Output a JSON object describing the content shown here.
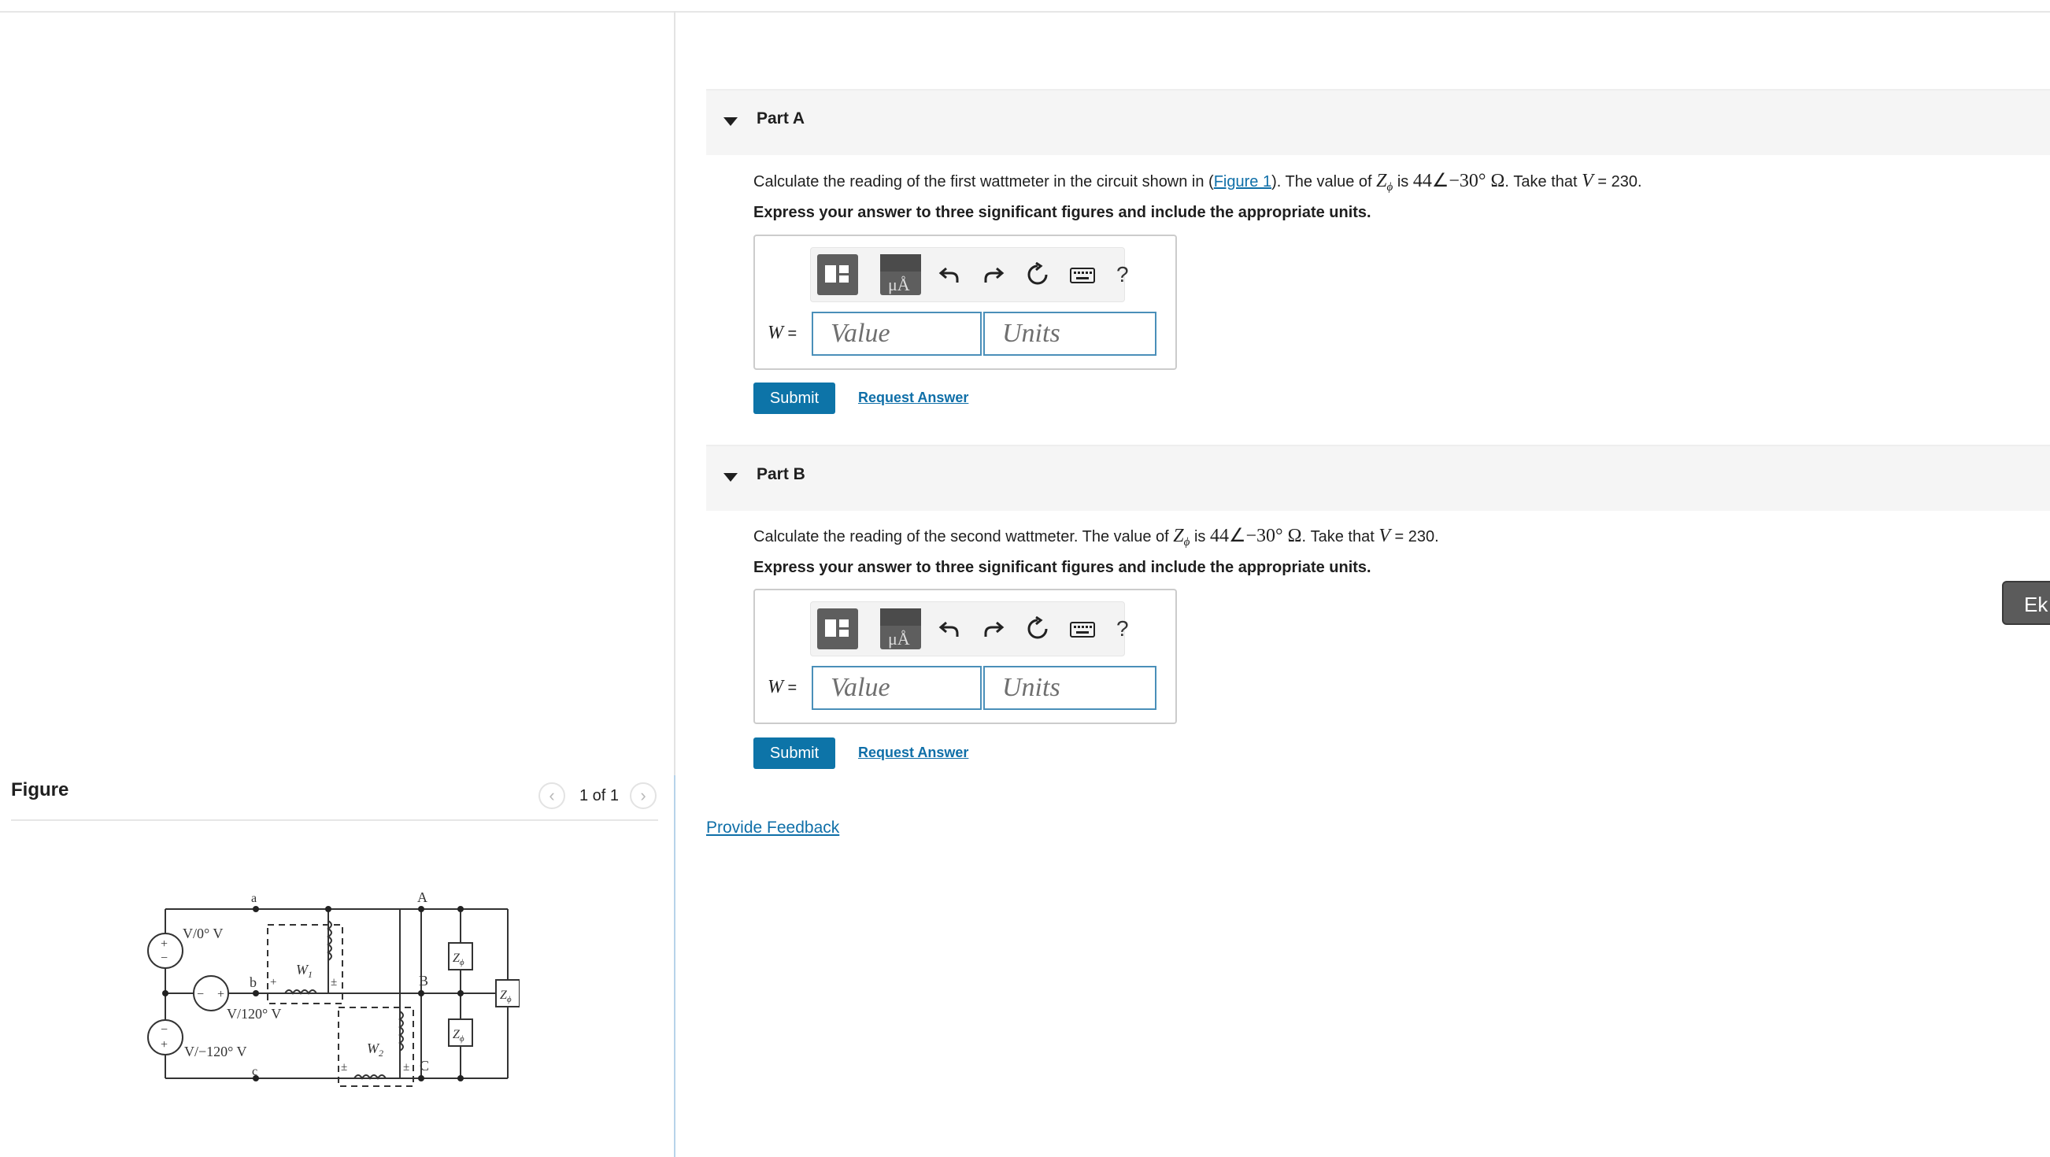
{
  "figure": {
    "title": "Figure",
    "pager_text": "1 of 1",
    "prev_icon": "chevron-left-icon",
    "next_icon": "chevron-right-icon",
    "circuit_labels": {
      "node_a": "a",
      "node_b": "b",
      "node_c": "c",
      "node_A": "A",
      "node_B": "B",
      "node_C": "C",
      "src1": "V/0° V",
      "src2": "V/120° V",
      "src3": "V/−120° V",
      "w1": "W",
      "w1_sub": "1",
      "w2": "W",
      "w2_sub": "2",
      "z": "Z",
      "z_sub": "ϕ",
      "plus": "+",
      "minus": "−",
      "plusminus": "±"
    }
  },
  "parts": [
    {
      "label": "Part A",
      "q_pre": "Calculate the reading of the first wattmeter in the circuit shown in (",
      "q_link": "Figure 1",
      "q_mid": "). The value of ",
      "q_z": "Z",
      "q_z_sub": "ϕ",
      "q_is": " is ",
      "q_value": "44∠−30° Ω",
      "q_take": ". Take that ",
      "q_v": "V",
      "q_vval": " = 230.",
      "express": "Express your answer to three significant figures and include the appropriate units.",
      "answer_label": "W",
      "answer_eq": " = ",
      "value_placeholder": "Value",
      "units_placeholder": "Units",
      "submit": "Submit",
      "request": "Request Answer",
      "toolbar_help": "?"
    },
    {
      "label": "Part B",
      "q_pre": "Calculate the reading of the second wattmeter. The value of ",
      "q_link": "",
      "q_mid": "",
      "q_z": "Z",
      "q_z_sub": "ϕ",
      "q_is": " is ",
      "q_value": "44∠−30° Ω",
      "q_take": ". Take that ",
      "q_v": "V",
      "q_vval": " = 230.",
      "express": "Express your answer to three significant figures and include the appropriate units.",
      "answer_label": "W",
      "answer_eq": " = ",
      "value_placeholder": "Value",
      "units_placeholder": "Units",
      "submit": "Submit",
      "request": "Request Answer",
      "toolbar_help": "?"
    }
  ],
  "feedback": "Provide Feedback",
  "side_tab": "Ek",
  "colors": {
    "link": "#0f6fa8",
    "submit": "#0d74a8",
    "field_border": "#4a8fb9"
  }
}
